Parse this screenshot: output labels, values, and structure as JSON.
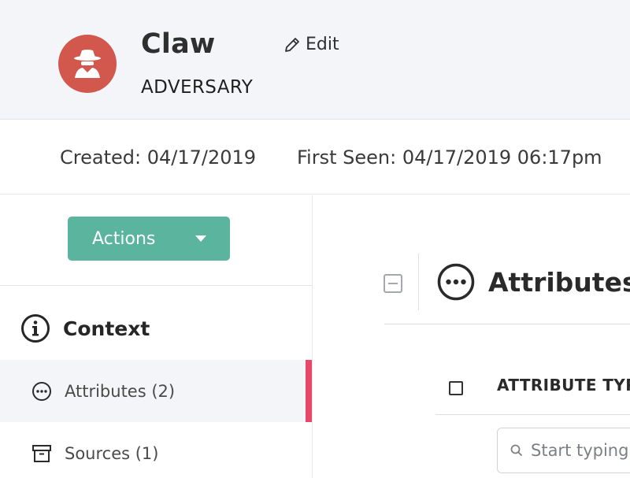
{
  "header": {
    "name": "Claw",
    "type": "ADVERSARY",
    "edit_label": "Edit",
    "avatar_color": "#d2574d"
  },
  "meta": {
    "created": "Created: 04/17/2019",
    "first_seen": "First Seen: 04/17/2019 06:17pm"
  },
  "sidebar": {
    "actions_label": "Actions",
    "actions_color": "#5bb59e",
    "context_heading": "Context",
    "items": [
      {
        "label": "Attributes (2)",
        "icon": "ellipsis-circle-icon",
        "active": true
      },
      {
        "label": "Sources (1)",
        "icon": "archive-box-icon",
        "active": false
      }
    ],
    "active_indicator_color": "#e8476a"
  },
  "main": {
    "section_title": "Attributes",
    "column_header": "ATTRIBUTE TYP",
    "search_placeholder": "Start typing"
  }
}
